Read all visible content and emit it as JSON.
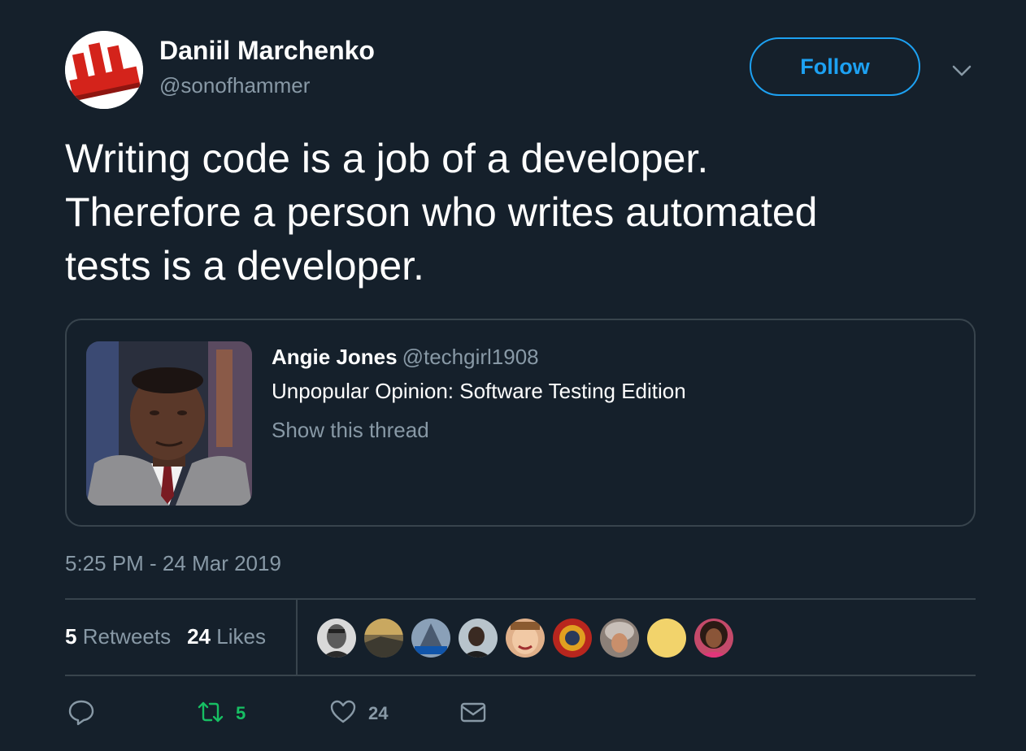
{
  "author": {
    "name": "Daniil Marchenko",
    "handle": "@sonofhammer"
  },
  "follow_label": "Follow",
  "tweet": {
    "lines": [
      "Writing code is a job of a developer.",
      "Therefore a person who writes automated",
      "tests is a developer."
    ]
  },
  "quote": {
    "name": "Angie Jones",
    "handle": "@techgirl1908",
    "text": "Unpopular Opinion: Software Testing Edition",
    "show_thread": "Show this thread"
  },
  "timestamp": "5:25 PM - 24 Mar 2019",
  "stats": {
    "retweets_count": "5",
    "retweets_label": "Retweets",
    "likes_count": "24",
    "likes_label": "Likes"
  },
  "actions": {
    "reply_icon": "reply-icon",
    "retweet_icon": "retweet-icon",
    "retweet_count": "5",
    "like_icon": "heart-icon",
    "like_count": "24",
    "dm_icon": "envelope-icon"
  },
  "colors": {
    "background": "#15202b",
    "accent": "#1da1f2",
    "secondary_text": "#8899a6",
    "border": "#38444d",
    "retweet_green": "#17bf63"
  }
}
